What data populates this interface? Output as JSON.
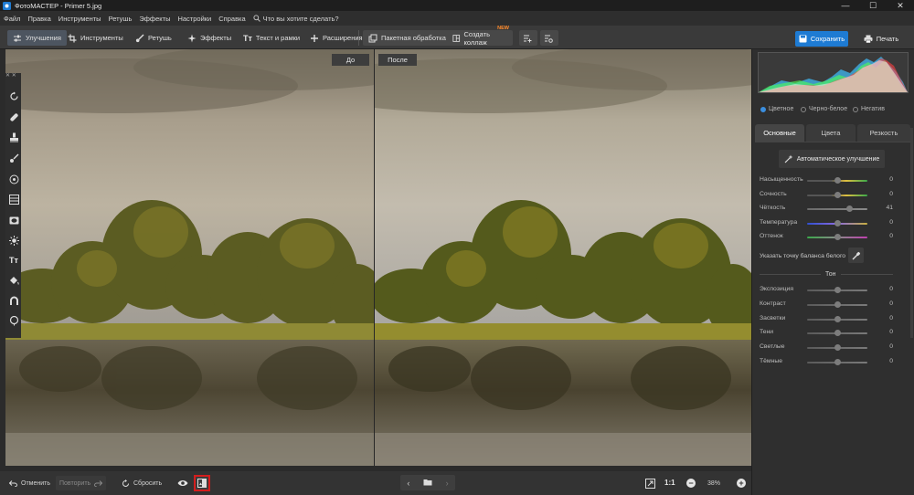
{
  "window": {
    "title": "ФотоМАСТЕР - Primer 5.jpg",
    "minimize": "—",
    "maximize": "☐",
    "close": "✕"
  },
  "menu": {
    "items": [
      "Файл",
      "Правка",
      "Инструменты",
      "Ретушь",
      "Эффекты",
      "Настройки",
      "Справка"
    ],
    "search_placeholder": "Что вы хотите сделать?"
  },
  "toolbar": {
    "tabs": [
      {
        "label": "Улучшения",
        "icon": "sliders-icon"
      },
      {
        "label": "Инструменты",
        "icon": "crop-icon"
      },
      {
        "label": "Ретушь",
        "icon": "brush-icon"
      },
      {
        "label": "Эффекты",
        "icon": "magic-icon"
      },
      {
        "label": "Текст и рамки",
        "icon": "text-icon"
      },
      {
        "label": "Расширения",
        "icon": "plus-icon"
      }
    ],
    "batch_label": "Пакетная обработка",
    "collage_label": "Создать коллаж",
    "collage_badge": "NEW",
    "save_label": "Сохранить",
    "print_label": "Печать"
  },
  "compare": {
    "before_label": "До",
    "after_label": "После"
  },
  "right_panel": {
    "modes": [
      {
        "label": "Цветное",
        "selected": true
      },
      {
        "label": "Черно-белое",
        "selected": false
      },
      {
        "label": "Негатив",
        "selected": false
      }
    ],
    "tabs": [
      "Основные",
      "Цвета",
      "Резкость"
    ],
    "auto_label": "Автоматическое улучшение",
    "sliders": [
      {
        "label": "Насыщенность",
        "value": "0",
        "gradient": "linear-gradient(90deg,#555,#555 40%,#e0c040 65%,#3aa84a)",
        "pos": 0.5
      },
      {
        "label": "Сочность",
        "value": "0",
        "gradient": "linear-gradient(90deg,#555,#555 40%,#e0c040 65%,#3aa84a)",
        "pos": 0.5
      },
      {
        "label": "Чёткость",
        "value": "41",
        "gradient": "linear-gradient(90deg,#6a6a6a,#8a8a8a)",
        "pos": 0.7
      },
      {
        "label": "Температура",
        "value": "0",
        "gradient": "linear-gradient(90deg,#3050d0,#8a6adf,#c8b040)",
        "pos": 0.5
      },
      {
        "label": "Оттенок",
        "value": "0",
        "gradient": "linear-gradient(90deg,#3aa84a,#8a8a8a,#c040b0)",
        "pos": 0.5
      }
    ],
    "white_balance_label": "Указать точку баланса белого",
    "tone_label": "Тон",
    "tone_sliders": [
      {
        "label": "Экспозиция",
        "value": "0",
        "pos": 0.5
      },
      {
        "label": "Контраст",
        "value": "0",
        "pos": 0.5
      },
      {
        "label": "Засветки",
        "value": "0",
        "pos": 0.5
      },
      {
        "label": "Тени",
        "value": "0",
        "pos": 0.5
      },
      {
        "label": "Светлые",
        "value": "0",
        "pos": 0.5
      },
      {
        "label": "Тёмные",
        "value": "0",
        "pos": 0.5
      }
    ]
  },
  "bottom": {
    "undo_label": "Отменить",
    "redo_label": "Повторить",
    "reset_label": "Сбросить",
    "one_to_one": "1:1",
    "zoom": "38%",
    "zoom_out": "−",
    "zoom_in": "+"
  },
  "colors": {
    "accent": "#1e7bd3",
    "highlight": "#d41d1d"
  }
}
